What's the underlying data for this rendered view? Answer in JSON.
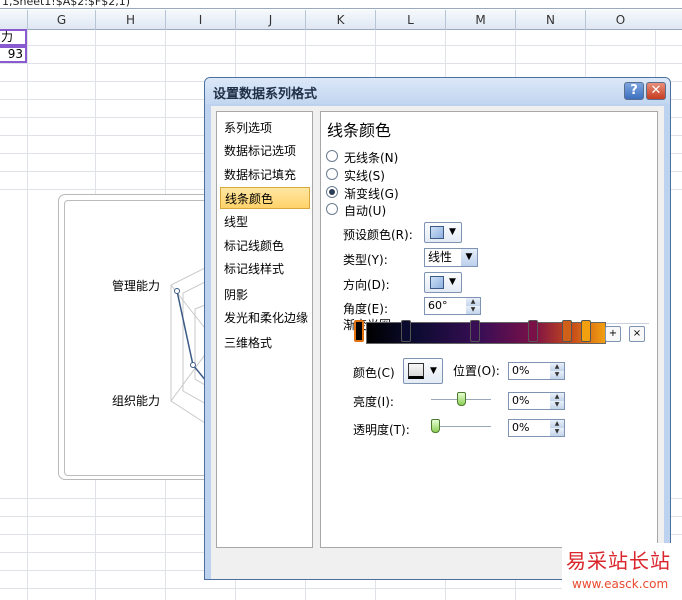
{
  "formula_bar": {
    "text": "1,Sheet1!$A$2:$F$2,1)"
  },
  "columns": [
    "G",
    "H",
    "I",
    "J",
    "K",
    "L",
    "M",
    "N",
    "O"
  ],
  "cells": {
    "label_cell": "力",
    "value_cell": "93"
  },
  "chart": {
    "label_top": "管理能力",
    "label_bottom": "组织能力"
  },
  "dialog": {
    "title": "设置数据系列格式",
    "help_label": "?",
    "close_label": "✕",
    "nav": [
      {
        "label": "系列选项"
      },
      {
        "label": "数据标记选项"
      },
      {
        "label": "数据标记填充"
      },
      {
        "label": "线条颜色",
        "selected": true
      },
      {
        "label": "线型"
      },
      {
        "label": "标记线颜色"
      },
      {
        "label": "标记线样式"
      },
      {
        "label": "阴影"
      },
      {
        "label": "发光和柔化边缘"
      },
      {
        "label": "三维格式"
      }
    ],
    "panel_title": "线条颜色",
    "radios": [
      {
        "label": "无线条(N)",
        "checked": false
      },
      {
        "label": "实线(S)",
        "checked": false
      },
      {
        "label": "渐变线(G)",
        "checked": true
      },
      {
        "label": "自动(U)",
        "checked": false
      }
    ],
    "preset_label": "预设颜色(R):",
    "type_label": "类型(Y):",
    "type_value": "线性",
    "direction_label": "方向(D):",
    "angle_label": "角度(E):",
    "angle_value": "60°",
    "gradient_stops_label": "渐变光圈",
    "color_label": "颜色(C)",
    "position_label": "位置(O):",
    "position_value": "0%",
    "brightness_label": "亮度(I):",
    "brightness_value": "0%",
    "transparency_label": "透明度(T):",
    "transparency_value": "0%"
  },
  "watermark": {
    "line1": "易采站长站",
    "line2": "www.easck.com"
  }
}
